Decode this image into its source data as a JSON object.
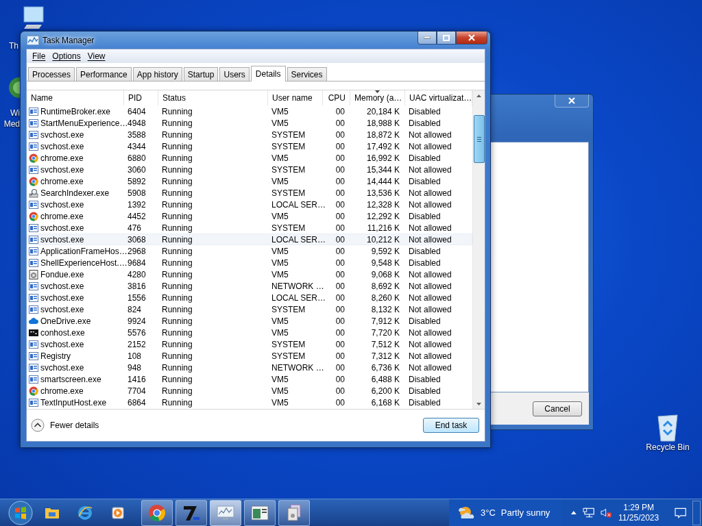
{
  "desktop_icons": [
    {
      "label": "Th",
      "kind": "computer"
    },
    {
      "label": "Wi Med",
      "kind": "media"
    },
    {
      "label": "Recycle Bin",
      "kind": "recycle"
    }
  ],
  "back_dialog": {
    "buttons": [
      "Cancel"
    ]
  },
  "window": {
    "title": "Task Manager"
  },
  "menu": [
    "File",
    "Options",
    "View"
  ],
  "tabs": [
    {
      "label": "Processes",
      "selected": false
    },
    {
      "label": "Performance",
      "selected": false
    },
    {
      "label": "App history",
      "selected": false
    },
    {
      "label": "Startup",
      "selected": false
    },
    {
      "label": "Users",
      "selected": false
    },
    {
      "label": "Details",
      "selected": true
    },
    {
      "label": "Services",
      "selected": false
    }
  ],
  "table": {
    "columns": [
      {
        "label": "Name",
        "sorted": false
      },
      {
        "label": "PID",
        "sorted": false
      },
      {
        "label": "Status",
        "sorted": false
      },
      {
        "label": "User name",
        "sorted": false
      },
      {
        "label": "CPU",
        "sorted": false
      },
      {
        "label": "Memory (a…",
        "sorted": true
      },
      {
        "label": "UAC virtualizat…",
        "sorted": false
      }
    ],
    "rows": [
      {
        "kind": "service",
        "hovered": false,
        "cells": [
          "RuntimeBroker.exe",
          "6404",
          "Running",
          "VM5",
          "00",
          "20,184 K",
          "Disabled"
        ]
      },
      {
        "kind": "service",
        "hovered": false,
        "cells": [
          "StartMenuExperience…",
          "4948",
          "Running",
          "VM5",
          "00",
          "18,988 K",
          "Disabled"
        ]
      },
      {
        "kind": "service",
        "hovered": false,
        "cells": [
          "svchost.exe",
          "3588",
          "Running",
          "SYSTEM",
          "00",
          "18,872 K",
          "Not allowed"
        ]
      },
      {
        "kind": "service",
        "hovered": false,
        "cells": [
          "svchost.exe",
          "4344",
          "Running",
          "SYSTEM",
          "00",
          "17,492 K",
          "Not allowed"
        ]
      },
      {
        "kind": "chrome",
        "hovered": false,
        "cells": [
          "chrome.exe",
          "6880",
          "Running",
          "VM5",
          "00",
          "16,992 K",
          "Disabled"
        ]
      },
      {
        "kind": "service",
        "hovered": false,
        "cells": [
          "svchost.exe",
          "3060",
          "Running",
          "SYSTEM",
          "00",
          "15,344 K",
          "Not allowed"
        ]
      },
      {
        "kind": "chrome",
        "hovered": false,
        "cells": [
          "chrome.exe",
          "5892",
          "Running",
          "VM5",
          "00",
          "14,444 K",
          "Disabled"
        ]
      },
      {
        "kind": "search",
        "hovered": false,
        "cells": [
          "SearchIndexer.exe",
          "5908",
          "Running",
          "SYSTEM",
          "00",
          "13,536 K",
          "Not allowed"
        ]
      },
      {
        "kind": "service",
        "hovered": false,
        "cells": [
          "svchost.exe",
          "1392",
          "Running",
          "LOCAL SER…",
          "00",
          "12,328 K",
          "Not allowed"
        ]
      },
      {
        "kind": "chrome",
        "hovered": false,
        "cells": [
          "chrome.exe",
          "4452",
          "Running",
          "VM5",
          "00",
          "12,292 K",
          "Disabled"
        ]
      },
      {
        "kind": "service",
        "hovered": false,
        "cells": [
          "svchost.exe",
          "476",
          "Running",
          "SYSTEM",
          "00",
          "11,216 K",
          "Not allowed"
        ]
      },
      {
        "kind": "service",
        "hovered": true,
        "cells": [
          "svchost.exe",
          "3068",
          "Running",
          "LOCAL SER…",
          "00",
          "10,212 K",
          "Not allowed"
        ]
      },
      {
        "kind": "service",
        "hovered": false,
        "cells": [
          "ApplicationFrameHos…",
          "2968",
          "Running",
          "VM5",
          "00",
          "9,592 K",
          "Disabled"
        ]
      },
      {
        "kind": "service",
        "hovered": false,
        "cells": [
          "ShellExperienceHost.…",
          "9684",
          "Running",
          "VM5",
          "00",
          "9,548 K",
          "Disabled"
        ]
      },
      {
        "kind": "disc",
        "hovered": false,
        "cells": [
          "Fondue.exe",
          "4280",
          "Running",
          "VM5",
          "00",
          "9,068 K",
          "Not allowed"
        ]
      },
      {
        "kind": "service",
        "hovered": false,
        "cells": [
          "svchost.exe",
          "3816",
          "Running",
          "NETWORK …",
          "00",
          "8,692 K",
          "Not allowed"
        ]
      },
      {
        "kind": "service",
        "hovered": false,
        "cells": [
          "svchost.exe",
          "1556",
          "Running",
          "LOCAL SER…",
          "00",
          "8,260 K",
          "Not allowed"
        ]
      },
      {
        "kind": "service",
        "hovered": false,
        "cells": [
          "svchost.exe",
          "824",
          "Running",
          "SYSTEM",
          "00",
          "8,132 K",
          "Not allowed"
        ]
      },
      {
        "kind": "cloud",
        "hovered": false,
        "cells": [
          "OneDrive.exe",
          "9924",
          "Running",
          "VM5",
          "00",
          "7,912 K",
          "Disabled"
        ]
      },
      {
        "kind": "console",
        "hovered": false,
        "cells": [
          "conhost.exe",
          "5576",
          "Running",
          "VM5",
          "00",
          "7,720 K",
          "Not allowed"
        ]
      },
      {
        "kind": "service",
        "hovered": false,
        "cells": [
          "svchost.exe",
          "2152",
          "Running",
          "SYSTEM",
          "00",
          "7,512 K",
          "Not allowed"
        ]
      },
      {
        "kind": "service",
        "hovered": false,
        "cells": [
          "Registry",
          "108",
          "Running",
          "SYSTEM",
          "00",
          "7,312 K",
          "Not allowed"
        ]
      },
      {
        "kind": "service",
        "hovered": false,
        "cells": [
          "svchost.exe",
          "948",
          "Running",
          "NETWORK …",
          "00",
          "6,736 K",
          "Not allowed"
        ]
      },
      {
        "kind": "service",
        "hovered": false,
        "cells": [
          "smartscreen.exe",
          "1416",
          "Running",
          "VM5",
          "00",
          "6,488 K",
          "Disabled"
        ]
      },
      {
        "kind": "chrome",
        "hovered": false,
        "cells": [
          "chrome.exe",
          "7704",
          "Running",
          "VM5",
          "00",
          "6,200 K",
          "Disabled"
        ]
      },
      {
        "kind": "service",
        "hovered": false,
        "cells": [
          "TextInputHost.exe",
          "6864",
          "Running",
          "VM5",
          "00",
          "6,168 K",
          "Disabled"
        ]
      }
    ]
  },
  "footer": {
    "toggle": "Fewer details",
    "button": "End task"
  },
  "taskbar": {
    "pinned": [
      {
        "kind": "folder"
      },
      {
        "kind": "ie"
      },
      {
        "kind": "media"
      }
    ],
    "open": [
      {
        "kind": "chrome",
        "selected": false
      },
      {
        "kind": "archive",
        "selected": false
      },
      {
        "kind": "monitor",
        "selected": true
      },
      {
        "kind": "window",
        "selected": false
      },
      {
        "kind": "files",
        "selected": false
      }
    ],
    "weather": {
      "temp": "3°C",
      "text": "Partly sunny"
    },
    "clock": {
      "time": "1:29 PM",
      "date": "11/25/2023"
    }
  }
}
